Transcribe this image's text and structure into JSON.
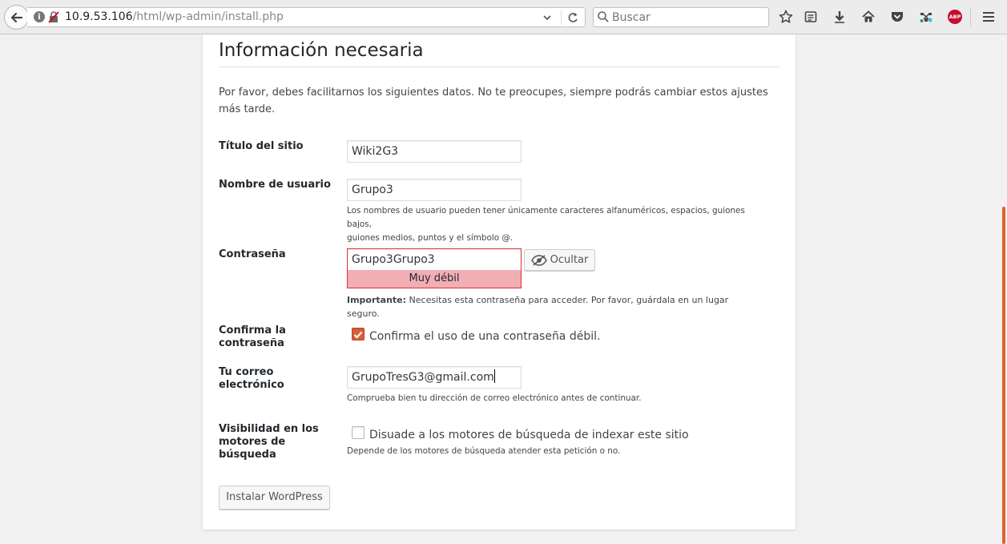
{
  "browser": {
    "url_host": "10.9.53.106",
    "url_path": "/html/wp-admin/install.php",
    "search_placeholder": "Buscar",
    "adblock_label": "ABP"
  },
  "page": {
    "heading": "Información necesaria",
    "intro": "Por favor, debes facilitarnos los siguientes datos. No te preocupes, siempre podrás cambiar estos ajustes más tarde."
  },
  "form": {
    "site_title": {
      "label": "Título del sitio",
      "value": "Wiki2G3"
    },
    "username": {
      "label": "Nombre de usuario",
      "value": "Grupo3",
      "hint_line1": "Los nombres de usuario pueden tener únicamente caracteres alfanuméricos, espacios, guiones bajos,",
      "hint_line2": "guiones medios, puntos y el símbolo @."
    },
    "password": {
      "label": "Contraseña",
      "value": "Grupo3Grupo3",
      "strength": "Muy débil",
      "hide_label": "Ocultar",
      "note_bold": "Importante:",
      "note": " Necesitas esta contraseña para acceder. Por favor, guárdala en un lugar seguro."
    },
    "confirm": {
      "label_line1": "Confirma la",
      "label_line2": "contraseña",
      "checkbox_label": "Confirma el uso de una contraseña débil.",
      "checked": true
    },
    "email": {
      "label_line1": "Tu correo",
      "label_line2": "electrónico",
      "value": "GrupoTresG3@gmail.com",
      "hint": "Comprueba bien tu dirección de correo electrónico antes de continuar."
    },
    "visibility": {
      "label_line1": "Visibilidad en los",
      "label_line2": "motores de",
      "label_line3": "búsqueda",
      "checkbox_label": "Disuade a los motores de búsqueda de indexar este sitio",
      "checked": false,
      "hint": "Depende de los motores de búsqueda atender esta petición o no."
    },
    "submit_label": "Instalar WordPress"
  },
  "colors": {
    "accent": "#d7603c",
    "weak_password_bg": "#f1aeb5",
    "weak_password_border": "#dc3232",
    "page_bg": "#f1f1f1"
  }
}
